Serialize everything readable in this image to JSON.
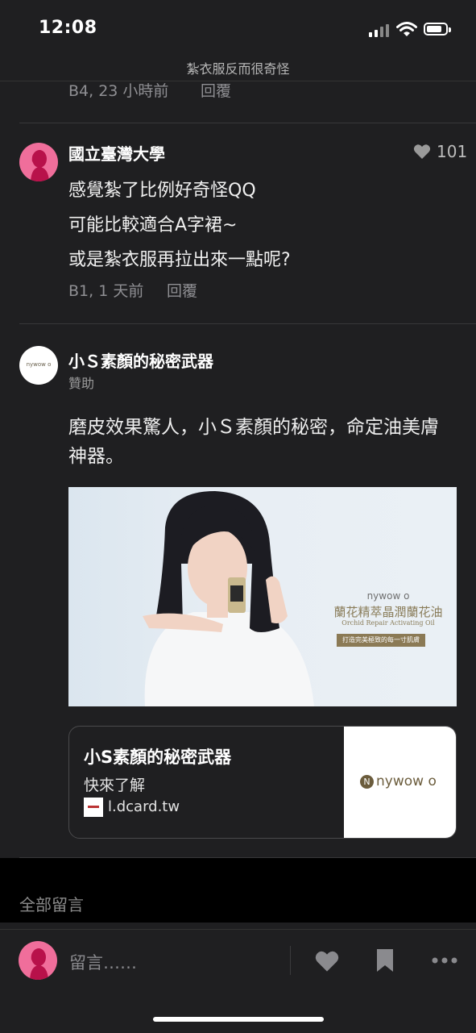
{
  "status_bar": {
    "time": "12:08"
  },
  "nav": {
    "title": "紮衣服反而很奇怪"
  },
  "prev_comment": {
    "meta": "B4, 23 小時前",
    "reply_label": "回覆"
  },
  "comment": {
    "author": "國立臺灣大學",
    "likes": "101",
    "lines": [
      "感覺紮了比例好奇怪QQ",
      "可能比較適合A字裙~",
      "或是紮衣服再拉出來一點呢?"
    ],
    "meta": "B1, 1 天前",
    "reply_label": "回覆"
  },
  "sponsored": {
    "name": "小Ｓ素顏的秘密武器",
    "tag": "贊助",
    "avatar_text": "nywow o",
    "text": "磨皮效果驚人，小Ｓ素顏的秘密，命定油美膚神器。",
    "image": {
      "brand": "nywow o",
      "product_cn": "蘭花精萃晶潤蘭花油",
      "product_en": "Orchid Repair Activating Oil",
      "tagline": "打造完美極致的每一寸肌膚"
    },
    "card": {
      "title": "小S素顏的秘密武器",
      "subtitle": "快來了解",
      "domain": "l.dcard.tw",
      "logo_text": "nywow o"
    }
  },
  "section": {
    "all_comments": "全部留言"
  },
  "bottom": {
    "placeholder": "留言……"
  },
  "colors": {
    "background": "#1f1f21",
    "avatar_pink": "#f06e9b",
    "text_muted": "#8f8f93"
  }
}
